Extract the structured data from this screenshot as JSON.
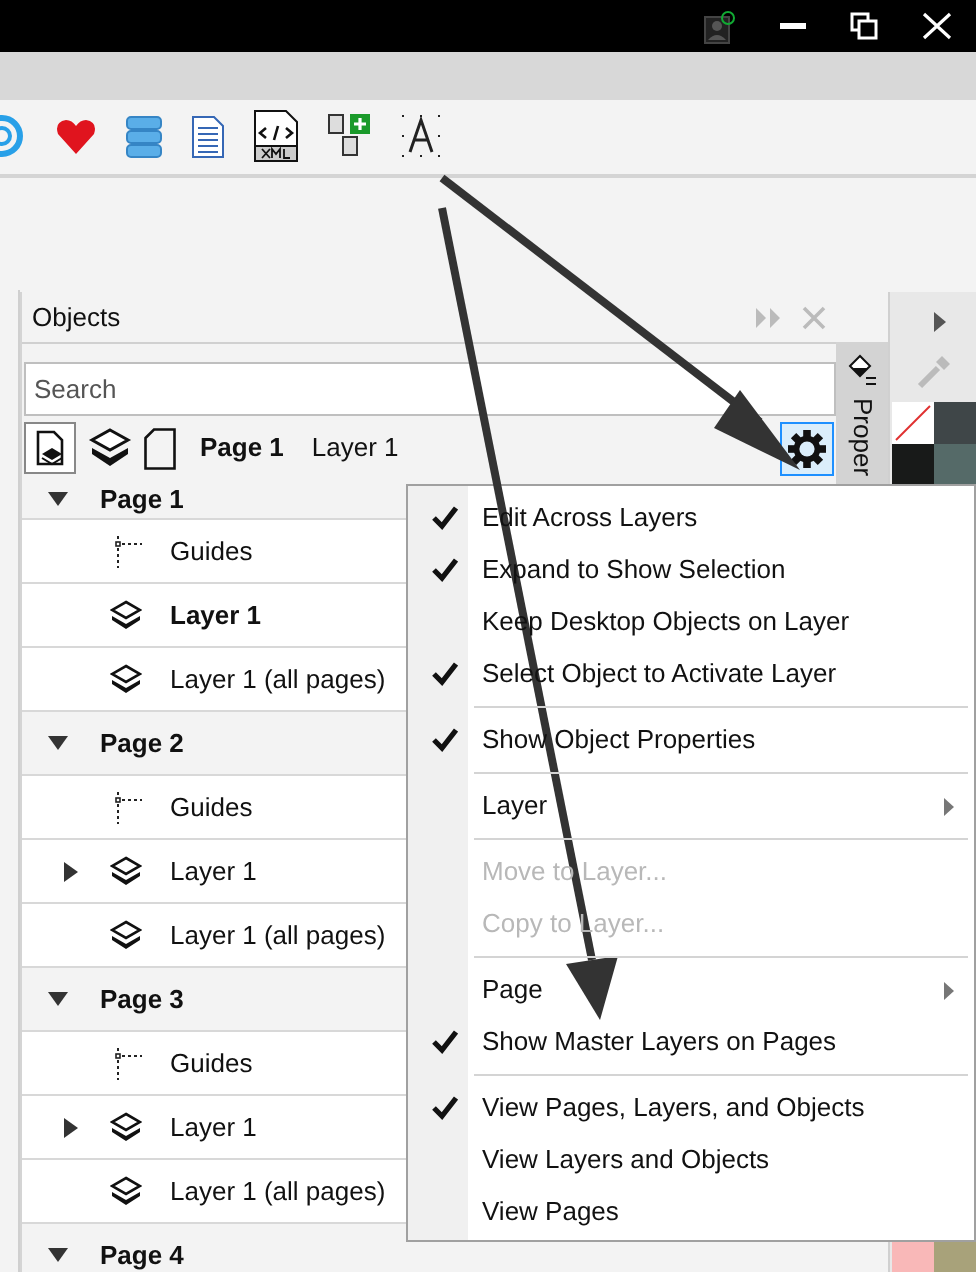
{
  "panel": {
    "title": "Objects",
    "search": {
      "placeholder": "Search"
    },
    "current_page": "Page 1",
    "current_layer": "Layer 1"
  },
  "side_tab": {
    "label": "Proper"
  },
  "tree": [
    {
      "label": "Page 1",
      "expanded": true,
      "children": [
        {
          "kind": "guides",
          "label": "Guides",
          "active": false,
          "expandable": false
        },
        {
          "kind": "layer",
          "label": "Layer 1",
          "active": true,
          "expandable": false
        },
        {
          "kind": "layer",
          "label": "Layer 1 (all pages)",
          "active": false,
          "expandable": false
        }
      ]
    },
    {
      "label": "Page 2",
      "expanded": true,
      "children": [
        {
          "kind": "guides",
          "label": "Guides",
          "active": false,
          "expandable": false
        },
        {
          "kind": "layer",
          "label": "Layer 1",
          "active": false,
          "expandable": true
        },
        {
          "kind": "layer",
          "label": "Layer 1 (all pages)",
          "active": false,
          "expandable": false
        }
      ]
    },
    {
      "label": "Page 3",
      "expanded": true,
      "children": [
        {
          "kind": "guides",
          "label": "Guides",
          "active": false,
          "expandable": false
        },
        {
          "kind": "layer",
          "label": "Layer 1",
          "active": false,
          "expandable": true
        },
        {
          "kind": "layer",
          "label": "Layer 1 (all pages)",
          "active": false,
          "expandable": false
        }
      ]
    },
    {
      "label": "Page 4",
      "expanded": true
    }
  ],
  "menu": [
    {
      "kind": "item",
      "label": "Edit Across Layers",
      "checked": true,
      "disabled": false
    },
    {
      "kind": "item",
      "label": "Expand to Show Selection",
      "checked": true,
      "disabled": false
    },
    {
      "kind": "item",
      "label": "Keep Desktop Objects on Layer",
      "checked": false,
      "disabled": false
    },
    {
      "kind": "item",
      "label": "Select Object to Activate Layer",
      "checked": true,
      "disabled": false
    },
    {
      "kind": "separator"
    },
    {
      "kind": "item",
      "label": "Show Object Properties",
      "checked": true,
      "disabled": false
    },
    {
      "kind": "separator"
    },
    {
      "kind": "submenu",
      "label": "Layer",
      "checked": false,
      "disabled": false
    },
    {
      "kind": "separator"
    },
    {
      "kind": "item",
      "label": "Move to Layer...",
      "checked": false,
      "disabled": true
    },
    {
      "kind": "item",
      "label": "Copy to Layer...",
      "checked": false,
      "disabled": true
    },
    {
      "kind": "separator"
    },
    {
      "kind": "submenu",
      "label": "Page",
      "checked": false,
      "disabled": false
    },
    {
      "kind": "item",
      "label": "Show Master Layers on Pages",
      "checked": true,
      "disabled": false
    },
    {
      "kind": "separator"
    },
    {
      "kind": "item",
      "label": "View Pages, Layers, and Objects",
      "checked": true,
      "disabled": false
    },
    {
      "kind": "item",
      "label": "View Layers and Objects",
      "checked": false,
      "disabled": false
    },
    {
      "kind": "item",
      "label": "View Pages",
      "checked": false,
      "disabled": false
    }
  ]
}
